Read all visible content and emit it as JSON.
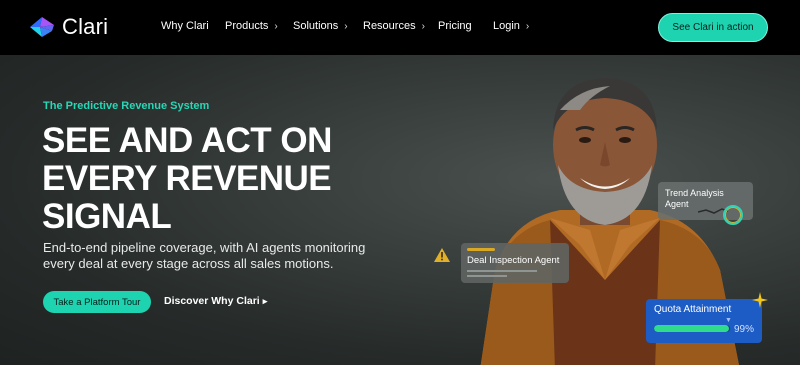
{
  "brand": {
    "name": "Clari",
    "icon": "clari-logo-icon"
  },
  "nav": {
    "items": [
      {
        "label": "Why Clari",
        "has_chevron": false
      },
      {
        "label": "Products",
        "has_chevron": true
      },
      {
        "label": "Solutions",
        "has_chevron": true
      },
      {
        "label": "Resources",
        "has_chevron": true
      },
      {
        "label": "Pricing",
        "has_chevron": false
      },
      {
        "label": "Login",
        "has_chevron": true
      }
    ],
    "chevron": "›",
    "cta_label": "See Clari in action"
  },
  "hero": {
    "eyebrow": "The Predictive Revenue System",
    "headline_lines": [
      "SEE AND ACT ON",
      "EVERY REVENUE",
      "SIGNAL"
    ],
    "description": "End-to-end pipeline coverage, with AI agents monitoring every deal at every stage across all sales motions.",
    "primary_button": "Take a Platform Tour",
    "secondary_link": "Discover Why Clari",
    "secondary_arrow": "▸"
  },
  "cards": {
    "trend": {
      "label": "Trend Analysis Agent"
    },
    "deal": {
      "label": "Deal Inspection Agent",
      "warning_icon": "warning-icon"
    },
    "quota": {
      "label": "Quota Attainment",
      "progress": 0.99,
      "percent_text": "99%"
    }
  },
  "colors": {
    "accent": "#1dd3b0",
    "quota_bg": "#1d5cc4",
    "warning": "#d9a926",
    "background": "#000000"
  }
}
